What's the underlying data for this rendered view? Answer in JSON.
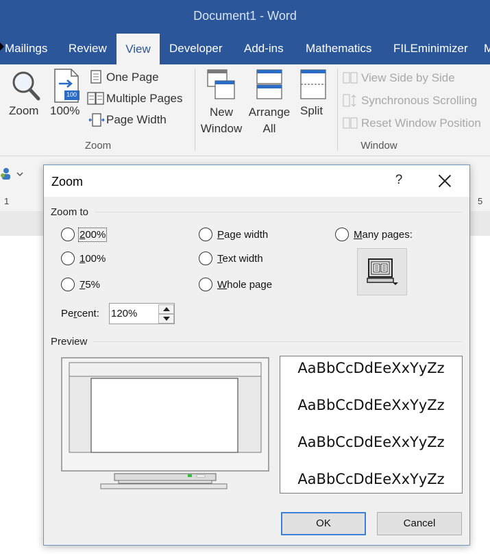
{
  "window": {
    "title": "Document1  -  Word"
  },
  "tabs": [
    {
      "label": "Mailings"
    },
    {
      "label": "Review"
    },
    {
      "label": "View",
      "active": true
    },
    {
      "label": "Developer"
    },
    {
      "label": "Add-ins"
    },
    {
      "label": "Mathematics"
    },
    {
      "label": "FILEminimizer"
    },
    {
      "label": "M"
    }
  ],
  "ribbon": {
    "zoom_group": {
      "label": "Zoom",
      "zoom_button": "Zoom",
      "hundred_button": "100%",
      "hundred_badge": "100",
      "one_page": "One Page",
      "multiple_pages": "Multiple Pages",
      "page_width": "Page Width"
    },
    "window_group": {
      "label": "Window",
      "new_window": [
        "New",
        "Window"
      ],
      "arrange_all": [
        "Arrange",
        "All"
      ],
      "split": "Split",
      "view_side_by_side": "View Side by Side",
      "synchronous_scrolling": "Synchronous Scrolling",
      "reset_window_position": "Reset Window Position"
    }
  },
  "ruler": {
    "left_mark": "1",
    "right_mark": "5"
  },
  "dialog": {
    "title": "Zoom",
    "help": "?",
    "zoom_to_label": "Zoom to",
    "options": {
      "z200": {
        "key": "2",
        "rest": "00%"
      },
      "z100": {
        "key": "1",
        "rest": "00%"
      },
      "z75": {
        "key": "7",
        "rest": "5%"
      },
      "page_width": {
        "key": "P",
        "rest": "age width"
      },
      "text_width": {
        "key": "T",
        "rest": "ext width"
      },
      "whole_page": {
        "key": "W",
        "rest": "hole page"
      },
      "many_pages": {
        "key": "M",
        "rest": "any pages:"
      }
    },
    "percent": {
      "pre": "Pe",
      "key": "r",
      "post": "cent:",
      "value": "120%"
    },
    "preview_label": "Preview",
    "sample_text": [
      "AaBbCcDdEeXxYyZz",
      "AaBbCcDdEeXxYyZz",
      "AaBbCcDdEeXxYyZz",
      "AaBbCcDdEeXxYyZz"
    ],
    "ok": "OK",
    "cancel": "Cancel"
  },
  "colors": {
    "word_blue": "#2b579a",
    "ribbon_bg": "#f3f3f3",
    "dialog_bg": "#f0f0f0",
    "default_button_border": "#3c7fd4"
  },
  "icons": {
    "zoom": "magnifier-icon",
    "hundred": "page-100-icon",
    "one_page": "one-page-icon",
    "multiple_pages": "multiple-pages-icon",
    "page_width": "page-width-icon",
    "new_window": "new-window-icon",
    "arrange_all": "arrange-all-icon",
    "split": "split-icon",
    "many_pages": "monitor-pages-icon"
  }
}
